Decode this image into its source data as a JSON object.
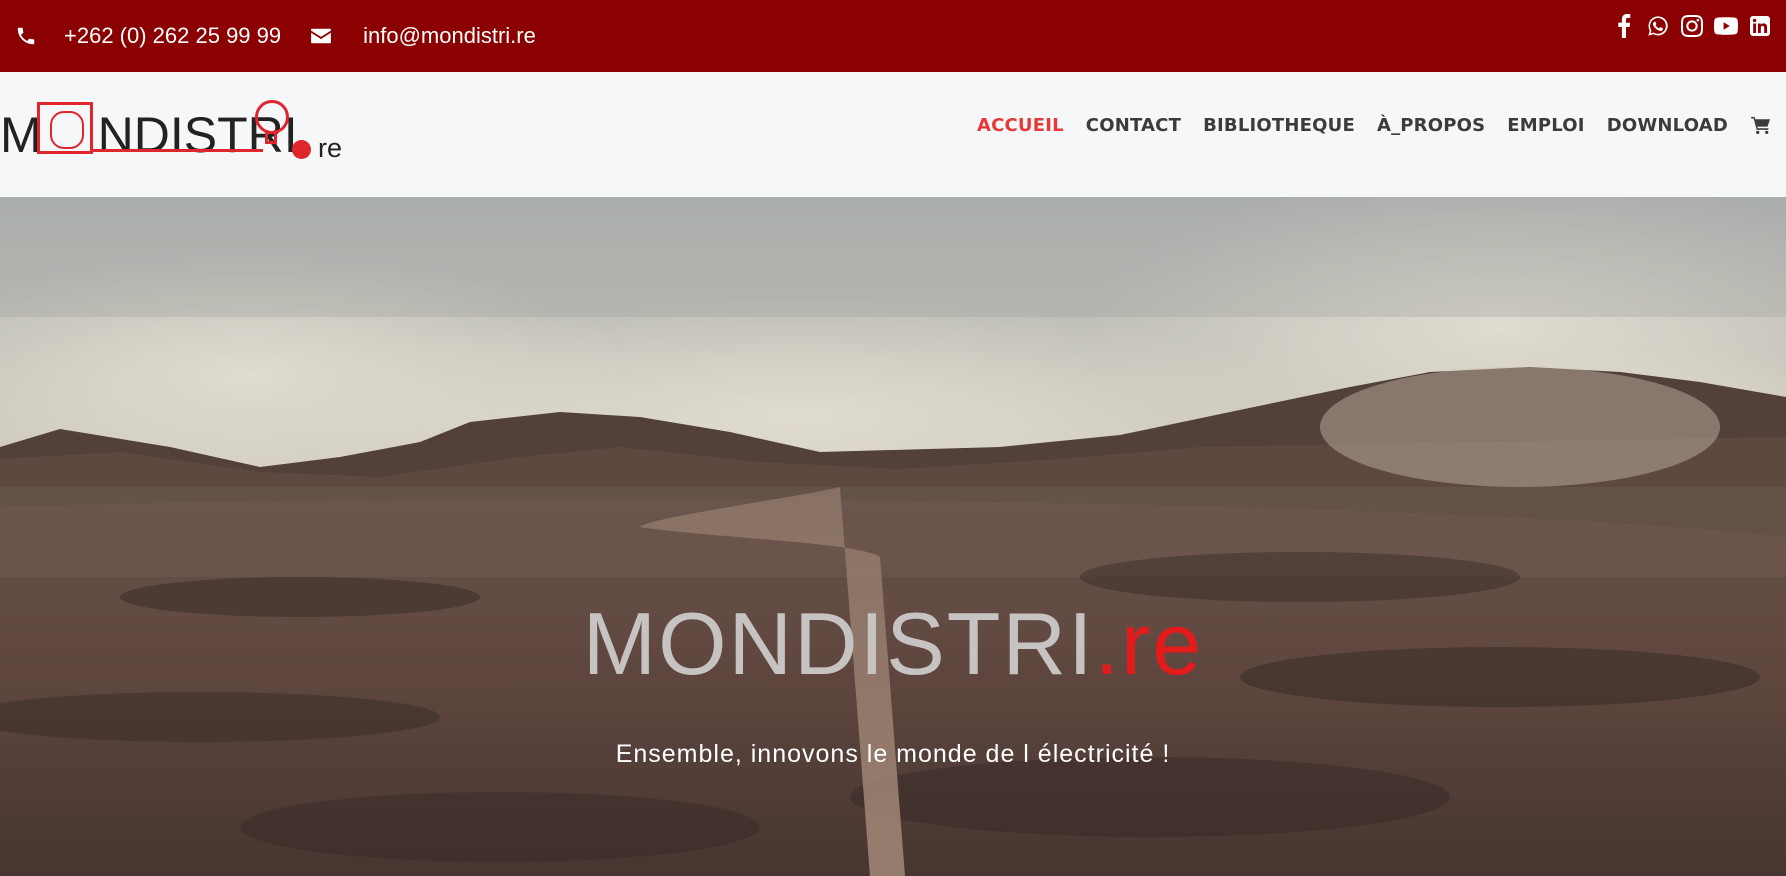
{
  "topbar": {
    "phone": "+262 (0) 262 25 99 99",
    "email": "info@mondistri.re",
    "social_icons": [
      "facebook-icon",
      "whatsapp-icon",
      "instagram-icon",
      "youtube-icon",
      "linkedin-icon"
    ]
  },
  "logo": {
    "word": "MONDISTRI",
    "suffix": "re"
  },
  "nav": {
    "items": [
      {
        "label": "ACCUEIL",
        "active": true
      },
      {
        "label": "CONTACT",
        "active": false
      },
      {
        "label": "BIBLIOTHEQUE",
        "active": false
      },
      {
        "label": "À_PROPOS",
        "active": false
      },
      {
        "label": "EMPLOI",
        "active": false
      },
      {
        "label": "DOWNLOAD",
        "active": false
      }
    ],
    "cart_icon": "cart-icon"
  },
  "hero": {
    "title_main": "MONDISTRI",
    "title_ext": ".re",
    "subtitle": "Ensemble, innovons le monde de l électricité !"
  },
  "colors": {
    "topbar_bg": "#8b0000",
    "accent_red": "#e41b1b",
    "nav_active": "#e63a3a",
    "nav_text": "#3b3b3b",
    "header_bg": "#f6f7f9"
  }
}
